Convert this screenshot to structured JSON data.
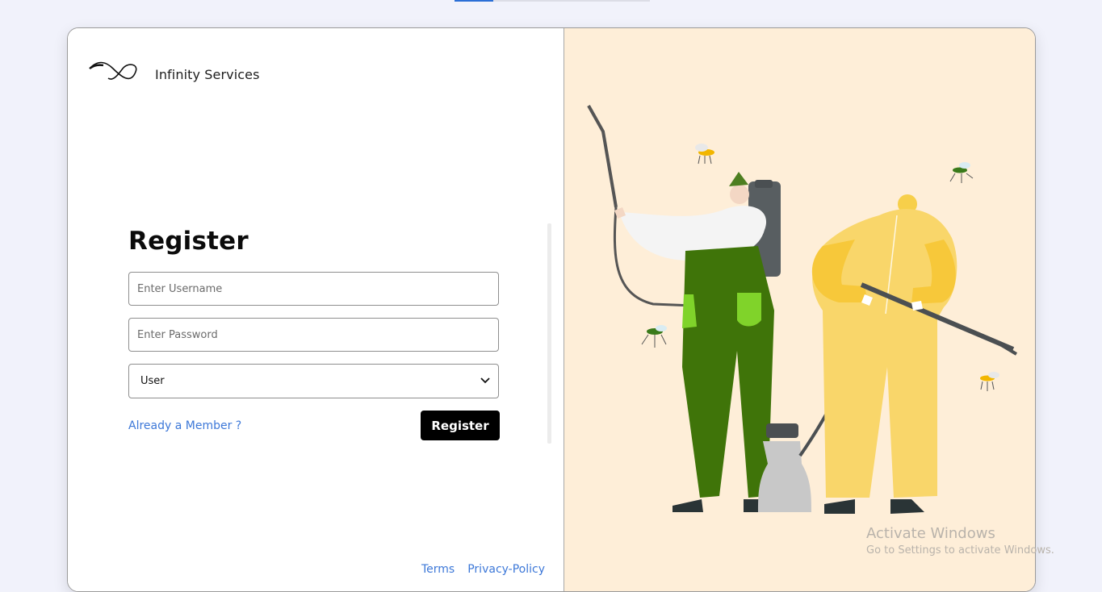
{
  "brand": {
    "name": "Infinity Services",
    "logo_icon": "infinity-wave-logo"
  },
  "form": {
    "title": "Register",
    "username_placeholder": "Enter Username",
    "password_placeholder": "Enter Password",
    "role_select_value": "User",
    "member_link": "Already a Member ?",
    "submit_label": "Register"
  },
  "footer": {
    "terms": "Terms",
    "privacy": "Privacy-Policy"
  },
  "watermark": {
    "line1": "Activate Windows",
    "line2": "Go to Settings to activate Windows."
  },
  "illustration": {
    "description_icon": "pest-control-workers-illustration",
    "background_color": "#feeed8"
  },
  "colors": {
    "link": "#3d78d8",
    "button_bg": "#000000",
    "page_bg": "#f1f2fb"
  }
}
